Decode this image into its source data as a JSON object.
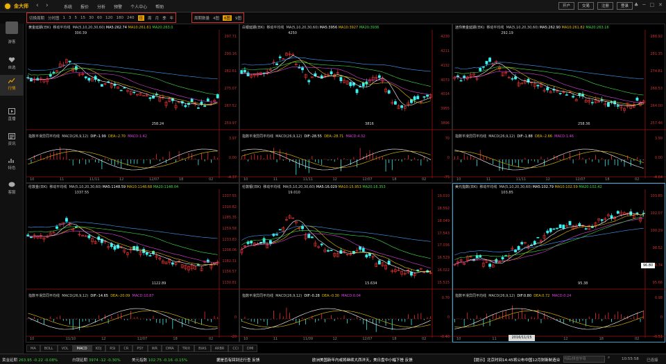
{
  "app": {
    "name": "金大师"
  },
  "menu": [
    "系统",
    "报价",
    "分析",
    "预警",
    "个人中心",
    "帮助"
  ],
  "top_buttons": [
    "开户",
    "交易",
    "注册",
    "登录"
  ],
  "periods": {
    "label1": "切换周期",
    "label2": "分时图",
    "items": [
      "1",
      "3",
      "5",
      "15",
      "30",
      "60",
      "120",
      "180",
      "240",
      "日",
      "周",
      "月",
      "季",
      "年"
    ],
    "selected": "日"
  },
  "layout": {
    "label": "周期数量",
    "items": [
      "4图",
      "6图",
      "9图"
    ],
    "selected": "6图"
  },
  "sidebar": [
    {
      "label": "游客",
      "icon": "user-avatar"
    },
    {
      "label": "自选",
      "icon": "heart-icon"
    },
    {
      "label": "行情",
      "icon": "chart-icon"
    },
    {
      "label": "直播",
      "icon": "play-icon"
    },
    {
      "label": "资讯",
      "icon": "news-icon"
    },
    {
      "label": "特色",
      "icon": "bars-icon"
    },
    {
      "label": "客服",
      "icon": "chat-icon"
    }
  ],
  "panels": [
    {
      "title": "黄金延期(日K)",
      "ma": "移动平均线",
      "ma_params": "MA(5,10,20,30,60)",
      "ma5": "MA5:262.74",
      "ma10": "MA10:261.61",
      "ma20": "MA20:263.0",
      "hi": "300.39",
      "lo": "258.24",
      "yticks": [
        "297.71",
        "290.16",
        "282.61",
        "275.07",
        "267.52",
        "259.97"
      ],
      "ind": "指数平滑异同平均线",
      "macd_params": "MACD(26,9,12)",
      "dif": "DIF:-1.99",
      "dea": "DEA:-2.70",
      "macd": "MACD:1.42",
      "ind_yticks": [
        "3.97",
        "0.00",
        "-4.37"
      ],
      "xlabels": [
        "10",
        "11",
        "11/11",
        "12",
        "12/07",
        "18",
        "02"
      ]
    },
    {
      "title": "白银延期(日K)",
      "ma": "移动平均线",
      "ma_params": "MA(5,10,20,30,60)",
      "ma5": "MA5:3956",
      "ma10": "MA10:3927",
      "ma20": "MA20:3936",
      "hi": "4250",
      "lo": "3816",
      "yticks": [
        "4230",
        "4211",
        "4132",
        "4073",
        "4014",
        "3955",
        "3896"
      ],
      "ind": "指数平滑异同平均线",
      "macd_params": "MACD(26,9,12)",
      "dif": "DIF:-28.55",
      "dea": "DEA:-28.71",
      "macd": "MACD:4.32",
      "ind_yticks": [
        "70",
        "0",
        "-75"
      ],
      "xlabels": [
        "10",
        "11",
        "11/11",
        "12",
        "12/07",
        "18",
        "02"
      ]
    },
    {
      "title": "迷你黄金延期(日K)",
      "ma": "移动平均线",
      "ma_params": "MA(5,10,20,30,60)",
      "ma5": "MA5:262.90",
      "ma10": "MA10:261.82",
      "ma20": "MA20:263.16",
      "hi": "292.19",
      "lo": "258.36",
      "yticks": [
        "288.92",
        "281.35",
        "274.81",
        "268.53",
        "264.00",
        "257.46"
      ],
      "ind": "指数平滑异同平均线",
      "macd_params": "MACD(26,9,12)",
      "dif": "DIF:-1.88",
      "dea": "DEA:-2.66",
      "macd": "MACD:1.46",
      "ind_yticks": [
        "3.99",
        "0.00",
        "-4.64"
      ],
      "xlabels": [
        "10",
        "11",
        "11/11",
        "12",
        "12/07",
        "18",
        "02"
      ]
    },
    {
      "title": "伦敦金(日K)",
      "ma": "移动平均线",
      "ma_params": "MA(5,10,20,30,60)",
      "ma5": "MA5:1148.59",
      "ma10": "MA10:1148.68",
      "ma20": "MA20:1148.04",
      "hi": "1337.55",
      "lo": "1122.89",
      "yticks": [
        "1337.55",
        "1310.82",
        "1285.35",
        "1259.58",
        "1233.83",
        "1208.06",
        "1182.31",
        "1156.57",
        "1130.81"
      ],
      "ind": "指数平滑异同平均线",
      "macd_params": "MACD(26,9,12)",
      "dif": "DIF:-14.65",
      "dea": "DEA:-20.09",
      "macd": "MACD:10.87",
      "ind_yticks": [
        "",
        "0",
        "-20"
      ],
      "xlabels": [
        "10",
        "11/10",
        "12",
        "12/07",
        "18",
        "02"
      ]
    },
    {
      "title": "伦敦银(日K)",
      "ma": "移动平均线",
      "ma_params": "MA(5,10,20,30,60)",
      "ma5": "MA5:16.029",
      "ma10": "MA10:15.953",
      "ma20": "MA20:16.353",
      "hi": "19.010",
      "lo": "15.634",
      "yticks": [
        "19.010",
        "18.592",
        "18.049",
        "17.543",
        "17.036",
        "16.529",
        "16.022",
        "15.515"
      ],
      "ind": "指数平滑异同平均线",
      "macd_params": "MACD(26,9,12)",
      "dif": "DIF:-0.28",
      "dea": "DEA:-0.30",
      "macd": "MACD:0.04",
      "ind_yticks": [
        "0.70",
        "0",
        "-0.40"
      ],
      "xlabels": [
        "10",
        "11",
        "11/09",
        "12",
        "12/07",
        "18",
        "02"
      ]
    },
    {
      "title": "美元指数(日K)",
      "ma": "移动平均线",
      "ma_params": "MA(5,10,20,30,60)",
      "ma5": "MA5:102.79",
      "ma10": "MA10:102.59",
      "ma20": "MA20:102.42",
      "hi": "103.85",
      "lo": "95.38",
      "yticks": [
        "103.85",
        "102.07",
        "100.29",
        "98.52",
        "96.74",
        "95.66"
      ],
      "ind": "指数平滑异同平均线",
      "macd_params": "MACD(26,9,12)",
      "dif": "DIF:0.80",
      "dea": "DEA:0.72",
      "macd": "MACD:0.24",
      "ind_yticks": [
        "0.98",
        "0",
        "-0.51"
      ],
      "xlabels": [
        "10",
        "11",
        "12",
        "12",
        "18",
        "02"
      ],
      "price_flag": "96.80",
      "date_flag": "2016/11/15"
    }
  ],
  "indicator_tabs": [
    "MA",
    "BOLL",
    "VOL",
    "MACD",
    "KDJ",
    "RSI",
    "CR",
    "PSY",
    "WR",
    "DMA",
    "TRIX",
    "BIAS",
    "ARBR",
    "CCI",
    "DMI"
  ],
  "indicator_selected": "MACD",
  "ticker": [
    {
      "name": "黄金延期",
      "value": "263.95",
      "chg": "-0.22",
      "pct": "-0.08%",
      "dir": "dn"
    },
    {
      "name": "白银延期",
      "value": "3974",
      "chg": "-12",
      "pct": "-0.30%",
      "dir": "dn"
    },
    {
      "name": "美元指数",
      "value": "102.75",
      "chg": "-0.16",
      "pct": "-0.15%",
      "dir": "dn"
    }
  ],
  "news": "据是否有回到迁行查 反馈",
  "news2": "欧洲美国新年内或将继续大西洋天，美日盘中小幅下挫 反馈",
  "news3": "【提示】北京时间14:45将公布中国12月财新制造业",
  "search_placeholder": "代码/拼音字母",
  "clock": "10:55:58",
  "connection": "已连接"
}
